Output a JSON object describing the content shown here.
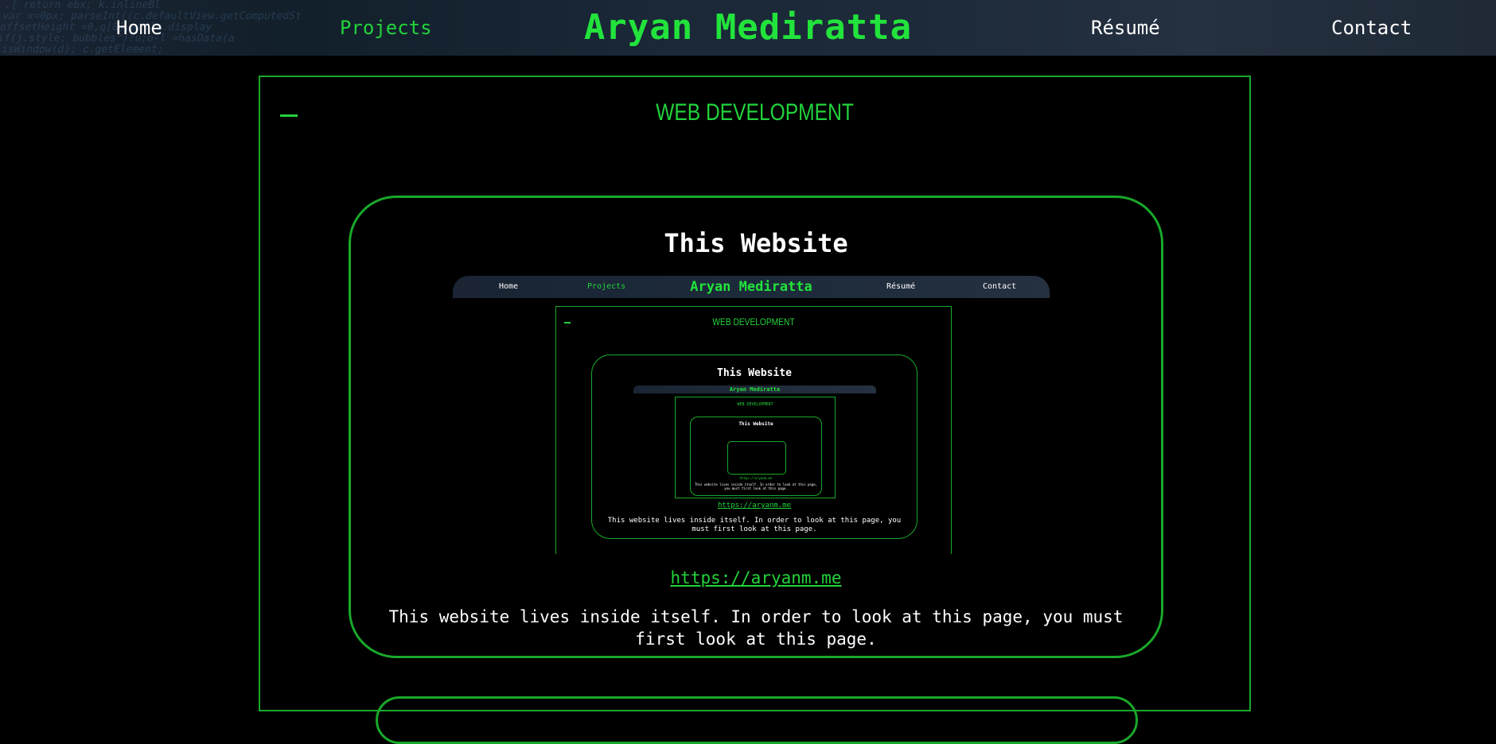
{
  "nav": {
    "home": "Home",
    "projects": "Projects",
    "brand": "Aryan Mediratta",
    "resume": "Résumé",
    "contact": "Contact"
  },
  "section": {
    "title": "WEB DEVELOPMENT",
    "collapse_symbol": "—"
  },
  "project": {
    "title": "This Website",
    "link": "https://aryanm.me",
    "description": "This website lives inside itself. In order to look at this page, you must first look at this page."
  },
  "preview": {
    "nav_home": "Home",
    "nav_projects": "Projects",
    "brand": "Aryan Mediratta",
    "nav_resume": "Résumé",
    "nav_contact": "Contact",
    "section_title": "WEB DEVELOPMENT",
    "card_title": "This Website",
    "link": "https://aryanm.me",
    "description": "This website lives inside itself. In order to look at this page, you must first look at this page.",
    "nested": {
      "brand": "Aryan Mediratta",
      "section_title": "WEB DEVELOPMENT",
      "card_title": "This Website",
      "link": "https://aryanm.me",
      "description": "This website lives inside itself. In order to look at this page, you must first look at this page."
    }
  },
  "colors": {
    "accent": "#22d33b",
    "border": "#19a82a",
    "background": "#000000",
    "navbar": "#1c2a3a"
  }
}
